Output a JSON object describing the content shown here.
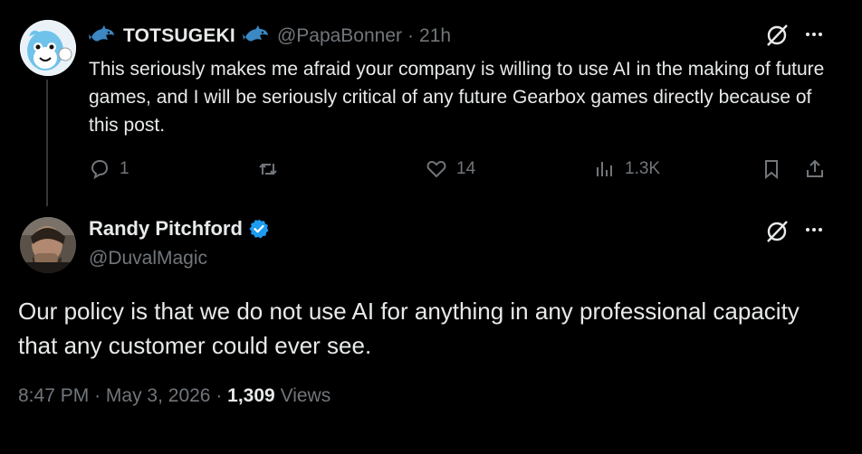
{
  "reply": {
    "display_name": "TOTSUGEKI",
    "handle": "@PapaBonner",
    "separator": "·",
    "time": "21h",
    "text": "This seriously makes me afraid your company is willing to use AI in the making of future games, and I will be seriously critical of any future Gearbox games directly because of this post.",
    "replies": "1",
    "likes": "14",
    "views": "1.3K"
  },
  "main": {
    "display_name": "Randy Pitchford",
    "handle": "@DuvalMagic",
    "text": "Our policy is that we do not use AI for anything in any professional capacity that any customer could ever see.",
    "time": "8:47 PM",
    "date": "May 3, 2026",
    "views_count": "1,309",
    "views_label": "Views",
    "sep": "·"
  },
  "icons": {
    "dolphin": "dolphin-emoji",
    "grok": "grok-icon",
    "more": "more-icon",
    "reply": "reply-icon",
    "retweet": "retweet-icon",
    "like": "heart-icon",
    "views": "views-icon",
    "bookmark": "bookmark-icon",
    "share": "share-icon",
    "verified": "verified-badge-icon"
  },
  "colors": {
    "background": "#000000",
    "text": "#e7e9ea",
    "muted": "#71767b",
    "verified": "#1d9bf0",
    "dolphin": "#3b88c3"
  }
}
